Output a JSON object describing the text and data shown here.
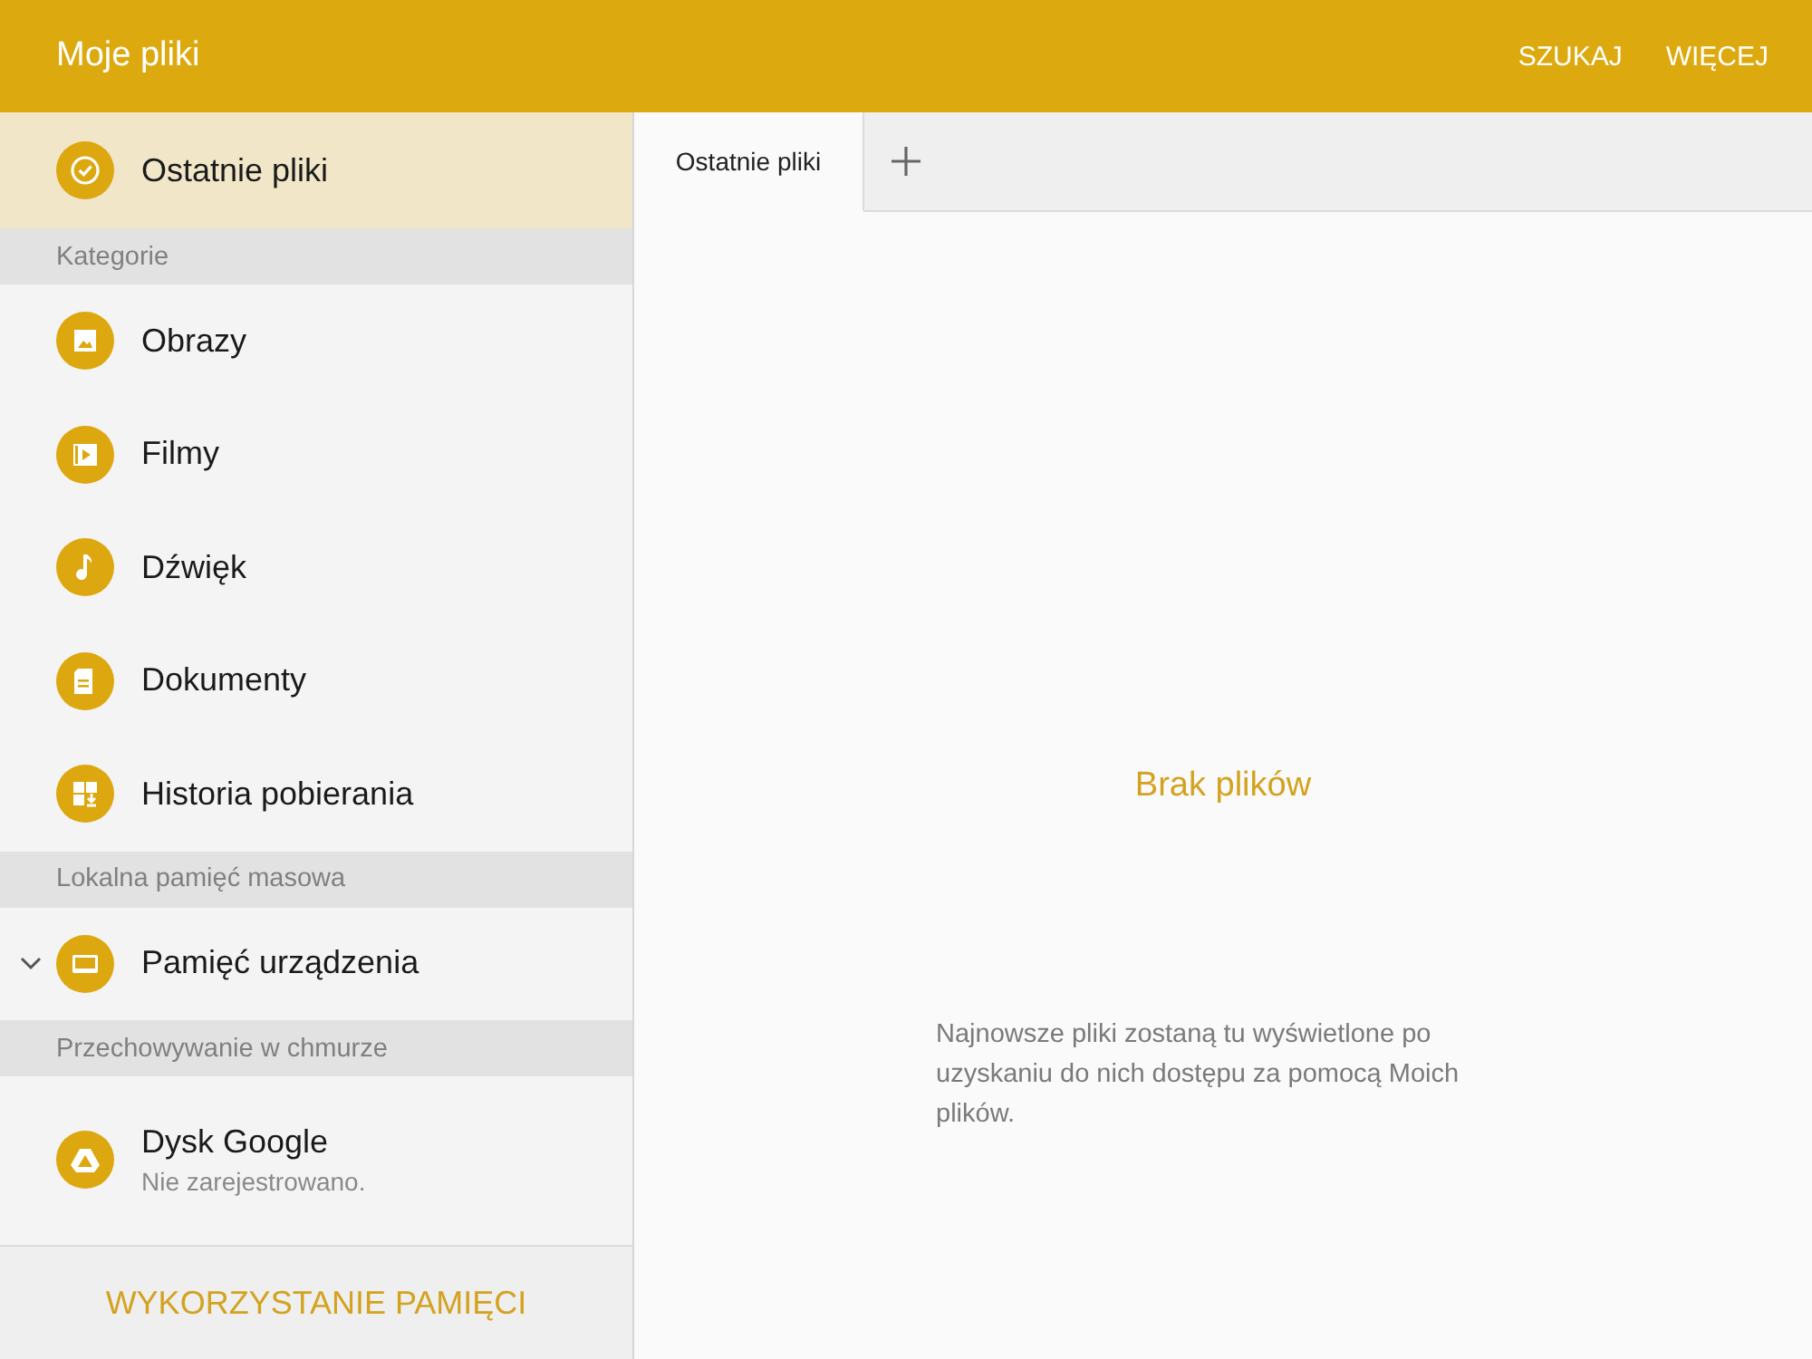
{
  "app_bar": {
    "title": "Moje pliki",
    "actions": [
      "SZUKAJ",
      "WIĘCEJ"
    ]
  },
  "sidebar": {
    "sections": [
      {
        "items": [
          {
            "label": "Ostatnie pliki",
            "kind": "recent",
            "selected": true
          }
        ]
      },
      {
        "title": "Kategorie",
        "items": [
          {
            "label": "Obrazy",
            "kind": "image",
            "selected": false
          },
          {
            "label": "Filmy",
            "kind": "video",
            "selected": false
          },
          {
            "label": "Dźwięk",
            "kind": "audio",
            "selected": false
          },
          {
            "label": "Dokumenty",
            "kind": "document",
            "selected": false
          },
          {
            "label": "Historia pobierania",
            "kind": "download",
            "selected": false
          }
        ]
      },
      {
        "title": "Lokalna pamięć masowa",
        "items": [
          {
            "label": "Pamięć urządzenia",
            "kind": "device",
            "selected": false,
            "expanded": false
          }
        ]
      },
      {
        "title": "Przechowywanie w chmurze",
        "items": [
          {
            "label": "Dysk Google",
            "subtitle": "Nie zarejestrowano.",
            "kind": "drive",
            "selected": false
          }
        ]
      }
    ],
    "footer_button": "WYKORZYSTANIE PAMIĘCI"
  },
  "tabs": [
    {
      "label": "Ostatnie pliki",
      "selected": true
    }
  ],
  "empty_state": {
    "title": "Brak plików",
    "message": "Najnowsze pliki zostaną tu wyświetlone po uzyskaniu do nich dostępu za pomocą Moich plików."
  }
}
